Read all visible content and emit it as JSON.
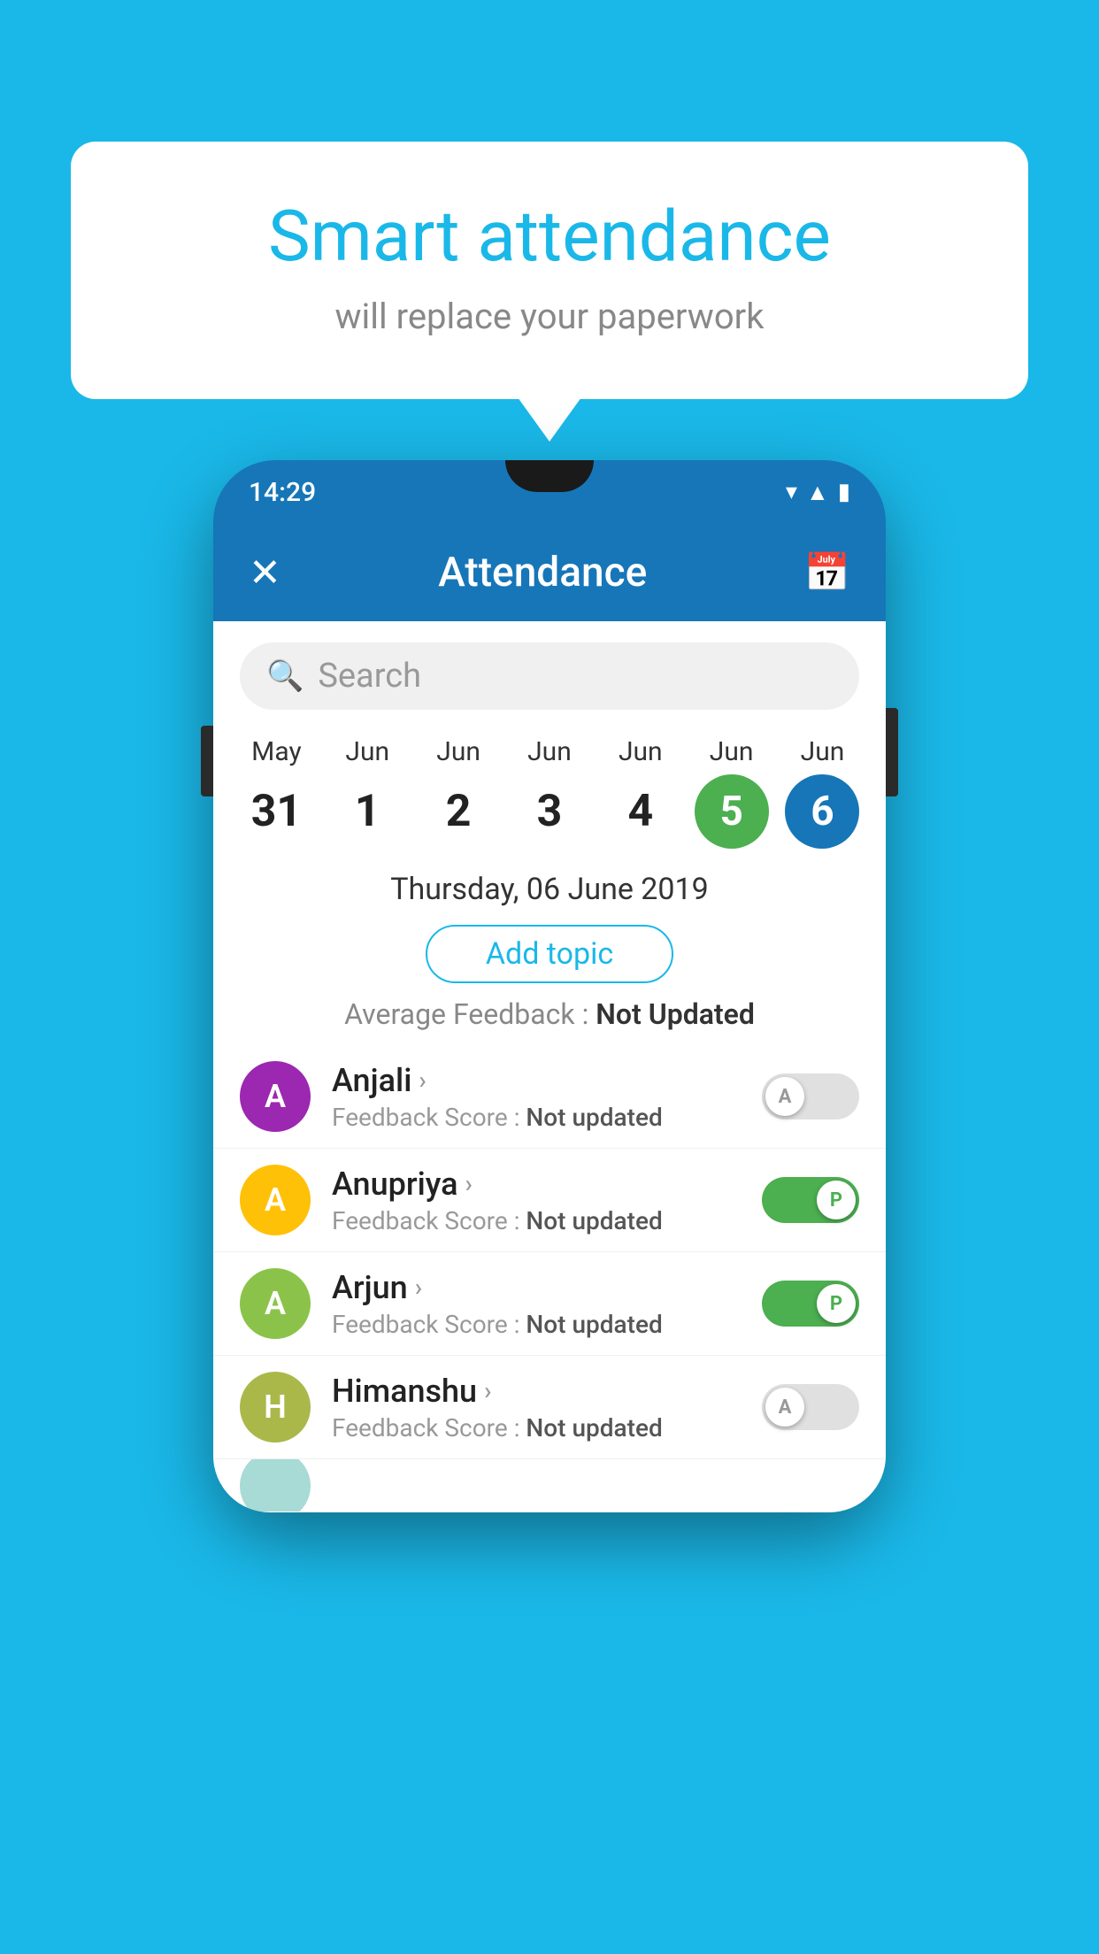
{
  "background_color": "#1ab8e8",
  "speech_bubble": {
    "title": "Smart attendance",
    "subtitle": "will replace your paperwork"
  },
  "phone": {
    "status_bar": {
      "time": "14:29",
      "icons": "▾ ▲ 🔋"
    },
    "header": {
      "close_label": "✕",
      "title": "Attendance",
      "calendar_icon": "📅"
    },
    "search": {
      "placeholder": "Search"
    },
    "calendar": {
      "days": [
        {
          "month": "May",
          "date": "31",
          "style": "normal"
        },
        {
          "month": "Jun",
          "date": "1",
          "style": "normal"
        },
        {
          "month": "Jun",
          "date": "2",
          "style": "normal"
        },
        {
          "month": "Jun",
          "date": "3",
          "style": "normal"
        },
        {
          "month": "Jun",
          "date": "4",
          "style": "normal"
        },
        {
          "month": "Jun",
          "date": "5",
          "style": "green"
        },
        {
          "month": "Jun",
          "date": "6",
          "style": "blue"
        }
      ]
    },
    "selected_date": "Thursday, 06 June 2019",
    "add_topic_label": "Add topic",
    "avg_feedback_label": "Average Feedback : ",
    "avg_feedback_value": "Not Updated",
    "students": [
      {
        "name": "Anjali",
        "avatar_letter": "A",
        "avatar_color": "purple",
        "feedback": "Feedback Score : ",
        "feedback_value": "Not updated",
        "toggle": "off",
        "toggle_label": "A"
      },
      {
        "name": "Anupriya",
        "avatar_letter": "A",
        "avatar_color": "yellow",
        "feedback": "Feedback Score : ",
        "feedback_value": "Not updated",
        "toggle": "on",
        "toggle_label": "P"
      },
      {
        "name": "Arjun",
        "avatar_letter": "A",
        "avatar_color": "light-green",
        "feedback": "Feedback Score : ",
        "feedback_value": "Not updated",
        "toggle": "on",
        "toggle_label": "P"
      },
      {
        "name": "Himanshu",
        "avatar_letter": "H",
        "avatar_color": "olive",
        "feedback": "Feedback Score : ",
        "feedback_value": "Not updated",
        "toggle": "off",
        "toggle_label": "A"
      }
    ]
  }
}
